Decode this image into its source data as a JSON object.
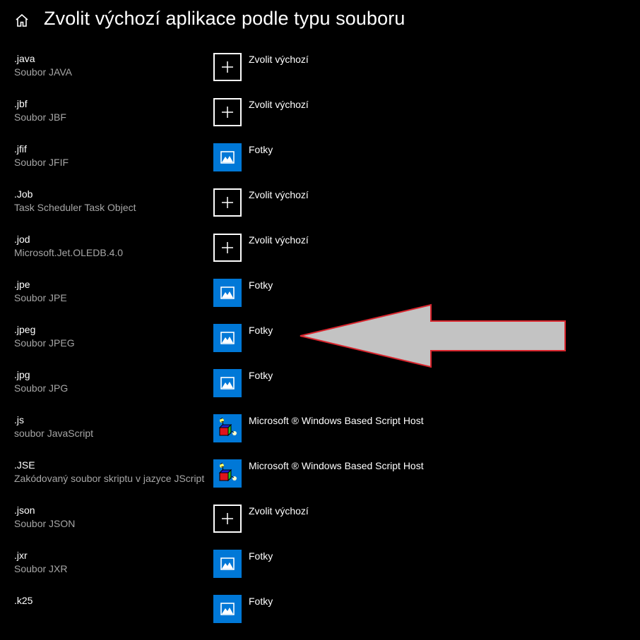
{
  "header": {
    "home_icon": "home-icon",
    "title": "Zvolit výchozí aplikace podle typu souboru"
  },
  "associations": [
    {
      "ext": ".java",
      "desc": "Soubor JAVA",
      "app": "Zvolit výchozí",
      "icon": "plus"
    },
    {
      "ext": ".jbf",
      "desc": "Soubor JBF",
      "app": "Zvolit výchozí",
      "icon": "plus"
    },
    {
      "ext": ".jfif",
      "desc": "Soubor JFIF",
      "app": "Fotky",
      "icon": "photos"
    },
    {
      "ext": ".Job",
      "desc": "Task Scheduler Task Object",
      "app": "Zvolit výchozí",
      "icon": "plus"
    },
    {
      "ext": ".jod",
      "desc": "Microsoft.Jet.OLEDB.4.0",
      "app": "Zvolit výchozí",
      "icon": "plus"
    },
    {
      "ext": ".jpe",
      "desc": "Soubor JPE",
      "app": "Fotky",
      "icon": "photos"
    },
    {
      "ext": ".jpeg",
      "desc": "Soubor JPEG",
      "app": "Fotky",
      "icon": "photos"
    },
    {
      "ext": ".jpg",
      "desc": "Soubor JPG",
      "app": "Fotky",
      "icon": "photos"
    },
    {
      "ext": ".js",
      "desc": "soubor JavaScript",
      "app": "Microsoft ® Windows Based Script Host",
      "icon": "wsh"
    },
    {
      "ext": ".JSE",
      "desc": "Zakódovaný soubor skriptu v jazyce JScript",
      "app": "Microsoft ® Windows Based Script Host",
      "icon": "wsh"
    },
    {
      "ext": ".json",
      "desc": "Soubor JSON",
      "app": "Zvolit výchozí",
      "icon": "plus"
    },
    {
      "ext": ".jxr",
      "desc": "Soubor JXR",
      "app": "Fotky",
      "icon": "photos"
    },
    {
      "ext": ".k25",
      "desc": "",
      "app": "Fotky",
      "icon": "photos"
    }
  ],
  "annotation": {
    "type": "arrow",
    "points_to": ".jpeg",
    "fill": "#c3c3c3",
    "stroke": "#d9262e"
  },
  "colors": {
    "background": "#000000",
    "accent": "#0078d7",
    "secondary_text": "#a6a6a6"
  }
}
